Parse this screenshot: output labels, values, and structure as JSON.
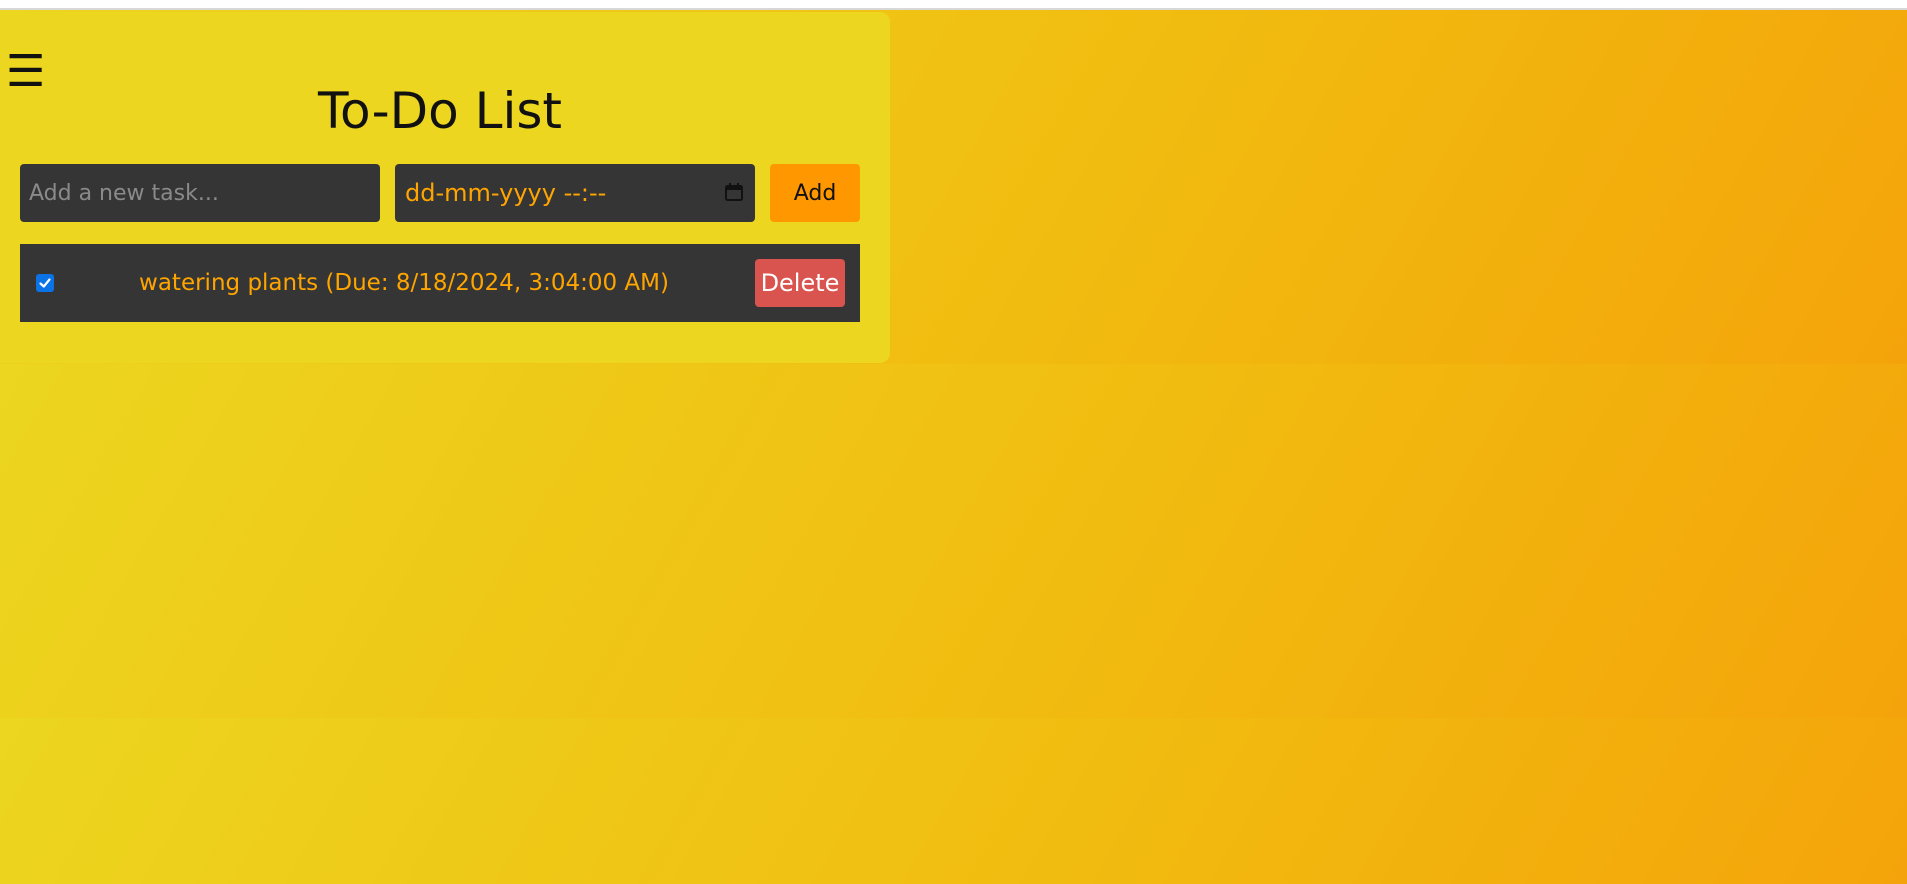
{
  "menu": {
    "icon": "hamburger-menu-icon",
    "glyph": "☰"
  },
  "page": {
    "title": "To-Do List"
  },
  "form": {
    "task_placeholder": "Add a new task...",
    "task_value": "",
    "date_placeholder": "dd-mm-yyyy --:--",
    "date_icon": "calendar-icon",
    "add_label": "Add"
  },
  "tasks": [
    {
      "checked": true,
      "text": "watering plants (Due: 8/18/2024, 3:04:00 AM)",
      "delete_label": "Delete"
    }
  ],
  "colors": {
    "accent": "#ff9800",
    "task_text": "#ffa500",
    "delete": "#d9534f",
    "panel": "#353535",
    "background": "#ecd61f"
  }
}
